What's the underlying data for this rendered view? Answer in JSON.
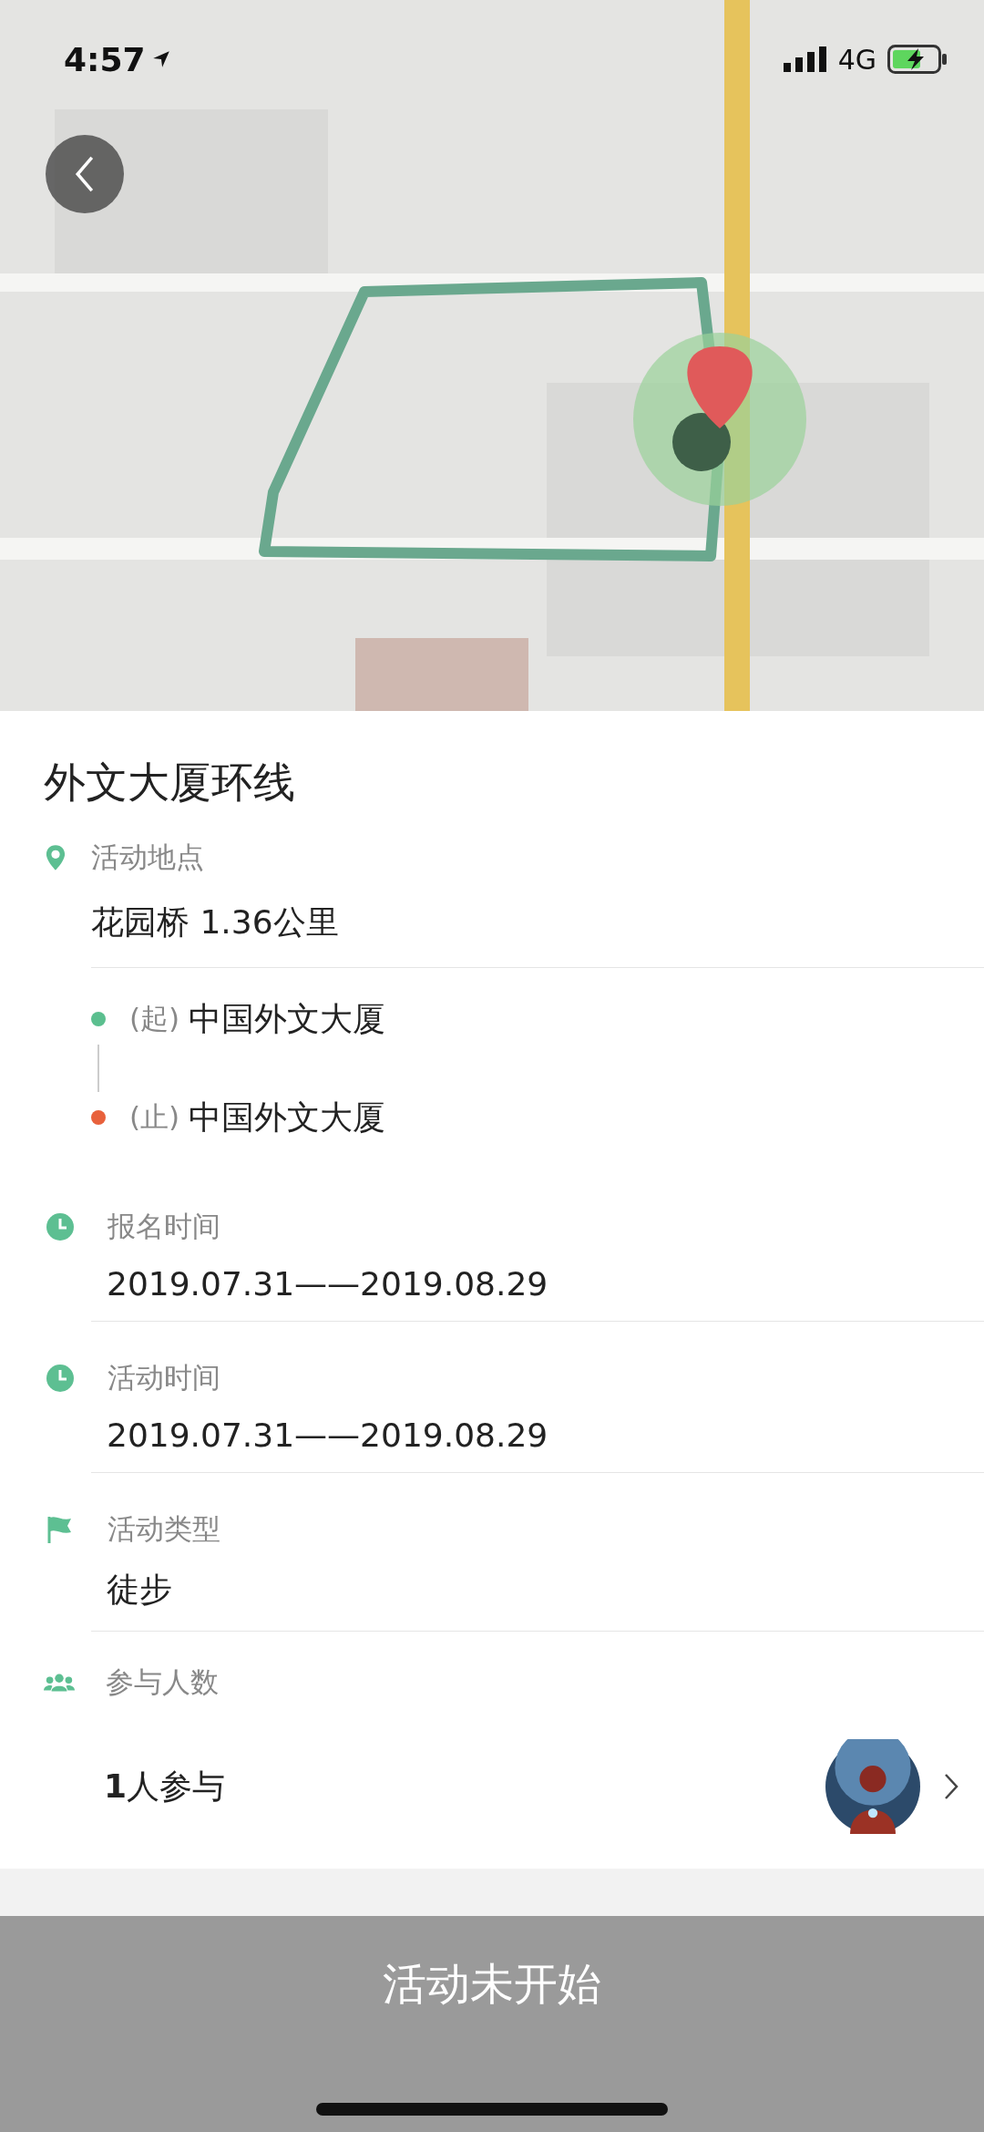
{
  "status_bar": {
    "time": "4:57",
    "network": "4G"
  },
  "title": "外文大厦环线",
  "location": {
    "label": "活动地点",
    "place": "花园桥  1.36公里",
    "stops": [
      {
        "tag": "(起)",
        "name": "中国外文大厦",
        "color": "#5bbf8f"
      },
      {
        "tag": "(止)",
        "name": "中国外文大厦",
        "color": "#e8613c"
      }
    ]
  },
  "fields": [
    {
      "kind": "clock",
      "label": "报名时间",
      "value": "2019.07.31——2019.08.29"
    },
    {
      "kind": "clock",
      "label": "活动时间",
      "value": "2019.07.31——2019.08.29"
    },
    {
      "kind": "flag",
      "label": "活动类型",
      "value": "徒步"
    }
  ],
  "participants": {
    "label": "参与人数",
    "count_text": "**1**人参与"
  },
  "action_button": "活动未开始"
}
